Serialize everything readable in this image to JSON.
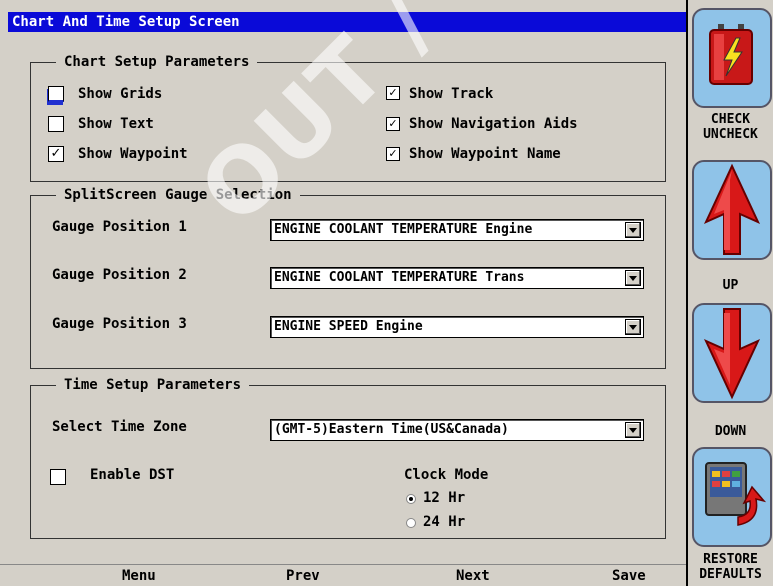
{
  "window": {
    "title": "Chart And Time Setup Screen"
  },
  "chart_setup": {
    "legend": "Chart Setup Parameters",
    "options": [
      {
        "label": "Show Grids",
        "checked": false
      },
      {
        "label": "Show Text",
        "checked": false
      },
      {
        "label": "Show Waypoint",
        "checked": true
      },
      {
        "label": "Show Track",
        "checked": true
      },
      {
        "label": "Show Navigation Aids",
        "checked": true
      },
      {
        "label": "Show Waypoint Name",
        "checked": true
      }
    ]
  },
  "gauge_selection": {
    "legend": "SplitScreen Gauge Selection",
    "rows": [
      {
        "label": "Gauge Position 1",
        "value": "ENGINE COOLANT TEMPERATURE Engine"
      },
      {
        "label": "Gauge Position 2",
        "value": "ENGINE COOLANT TEMPERATURE Trans"
      },
      {
        "label": "Gauge Position 3",
        "value": "ENGINE SPEED Engine"
      }
    ]
  },
  "time_setup": {
    "legend": "Time Setup Parameters",
    "time_zone_label": "Select Time Zone",
    "time_zone_value": "(GMT-5)Eastern Time(US&Canada)",
    "dst_label": "Enable DST",
    "dst_checked": false,
    "clock_mode_label": "Clock Mode",
    "clock_options": [
      {
        "label": "12 Hr",
        "selected": true
      },
      {
        "label": "24 Hr",
        "selected": false
      }
    ]
  },
  "bottom_nav": {
    "menu": "Menu",
    "prev": "Prev",
    "next": "Next",
    "save": "Save"
  },
  "side_buttons": {
    "check_line1": "CHECK",
    "check_line2": "UNCHECK",
    "up": "UP",
    "down": "DOWN",
    "restore_line1": "RESTORE",
    "restore_line2": "DEFAULTS"
  },
  "watermark": "OUT / DISC",
  "icons": {
    "check_uncheck": "battery-lightning-icon",
    "up": "up-arrow-icon",
    "down": "down-arrow-icon",
    "restore": "restore-defaults-icon"
  },
  "colors": {
    "titlebar": "#0a0ad8",
    "tile": "#8fc3e8",
    "arrow": "#d81818"
  }
}
